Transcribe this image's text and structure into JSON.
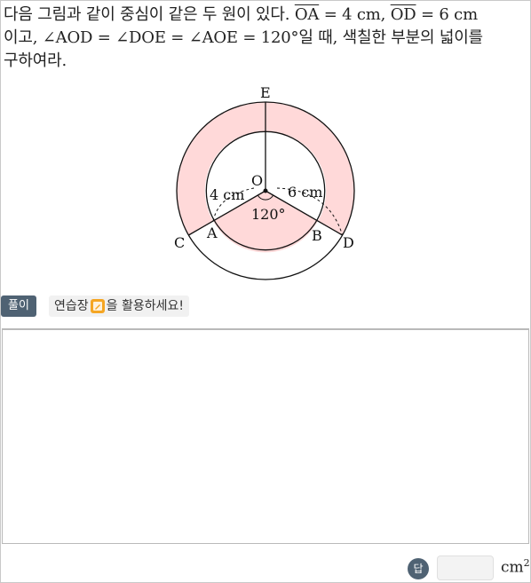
{
  "problem": {
    "line1_text": "다음 그림과 같이 중심이 같은 두 원이 있다. ",
    "seg_oa": "OA",
    "eq_oa": " = 4 cm, ",
    "seg_od": "OD",
    "eq_od": " = 6 cm",
    "line2_text": "이고, ∠AOD = ∠DOE = ∠AOE = 120°일 때, 색칠한 부분의 넓이를",
    "line3_text": "구하여라."
  },
  "figure": {
    "labels": {
      "E": "E",
      "O": "O",
      "A": "A",
      "B": "B",
      "C": "C",
      "D": "D",
      "inner_radius": "4 cm",
      "outer_radius": "6 cm",
      "angle": "120°"
    },
    "shade_color": "#ffd9d9",
    "stroke_color": "#111111"
  },
  "solution": {
    "badge_label": "풀이",
    "hint_prefix": "연습장",
    "hint_suffix": "을 활용하세요!",
    "hint_icon": "pencil-icon"
  },
  "answer": {
    "badge_label": "답",
    "value": "",
    "unit": "cm",
    "unit_power": "2"
  }
}
